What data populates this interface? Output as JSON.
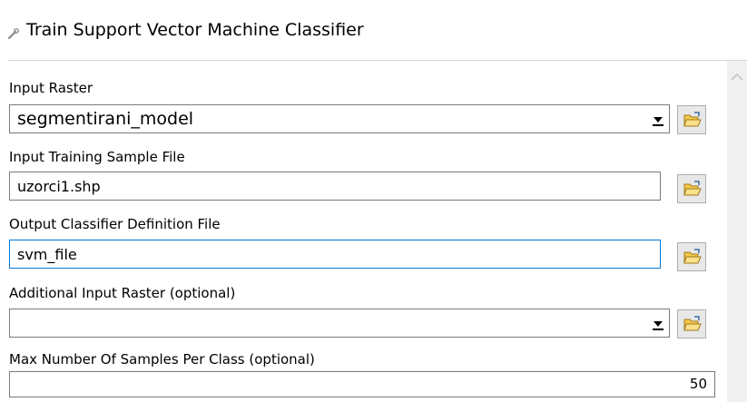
{
  "window": {
    "title": "Train Support Vector Machine Classifier",
    "title_icon": "wrench-tool-icon"
  },
  "form": {
    "input_raster": {
      "label": "Input Raster",
      "value": "segmentirani_model",
      "control": "dropdown",
      "browse_icon": "open-folder-icon"
    },
    "training_sample": {
      "label": "Input Training Sample File",
      "value": "uzorci1.shp",
      "control": "text",
      "browse_icon": "open-folder-icon"
    },
    "classifier_output": {
      "label": "Output Classifier Definition File",
      "value": "svm_file",
      "control": "text",
      "focused": true,
      "browse_icon": "open-folder-icon"
    },
    "additional_raster": {
      "label": "Additional Input Raster (optional)",
      "value": "",
      "control": "dropdown",
      "browse_icon": "open-folder-icon"
    },
    "max_samples": {
      "label": "Max Number Of Samples Per Class (optional)",
      "value": "50",
      "control": "number"
    }
  },
  "scrollbar": {
    "icon": "chevron-up-icon"
  },
  "colors": {
    "focus_border": "#0078d7",
    "field_border": "#7a7a7a",
    "scrollbar_track": "#f0f0f0",
    "folder_fill": "#f5c84a"
  }
}
